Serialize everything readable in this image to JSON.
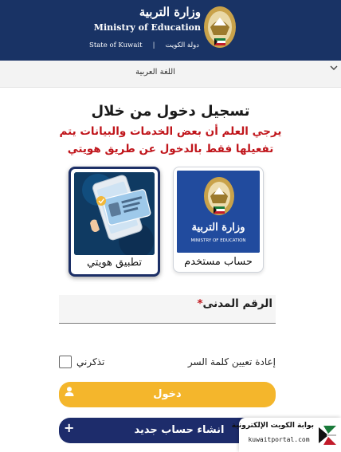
{
  "header": {
    "title_ar": "وزارة التربية",
    "title_en": "Ministry of Education",
    "state_en": "State of Kuwait",
    "state_separator": "|",
    "state_ar": "دولة الكويت",
    "colors": {
      "background": "#193365",
      "text": "#ffffff"
    }
  },
  "language_bar": {
    "label": "اللغة العربية",
    "chevron_icon": "chevron-down-icon"
  },
  "login": {
    "title": "تسجيل دخول من خلال",
    "notice_line1": "يرجي العلم أن بعض الخدمات والبيانات يتم",
    "notice_line2": "تفعيلها فقط بالدخول عن طريق هويتي",
    "notice_color": "#c0151b"
  },
  "options": [
    {
      "label": "تطبيق هويتي",
      "icon": "hawyti-app-icon",
      "selected": true
    },
    {
      "label": "حساب مستخدم",
      "icon": "ministry-emblem-icon",
      "selected": false
    },
    {
      "card_caption_ar": "وزارة التربية",
      "card_caption_en": "MINISTRY OF EDUCATION"
    }
  ],
  "form": {
    "civil_id_label": "الرقم المدنى",
    "required_mark": "*",
    "civil_id_value": "",
    "remember_me_label": "تذكرني",
    "remember_me_checked": false,
    "reset_password_label": "إعادة تعيين كلمة السر"
  },
  "buttons": {
    "login_label": "دخول",
    "login_icon": "user-icon",
    "login_color": "#f4b62c",
    "register_label": "انشاء حساب جديد",
    "register_icon": "plus-icon",
    "register_color": "#1d2c6b"
  },
  "portal_badge": {
    "name_ar": "بوابة الكويت الإلكترونية",
    "url": "kuwaitportal.com",
    "logo_icon": "kuwait-portal-logo-icon"
  }
}
